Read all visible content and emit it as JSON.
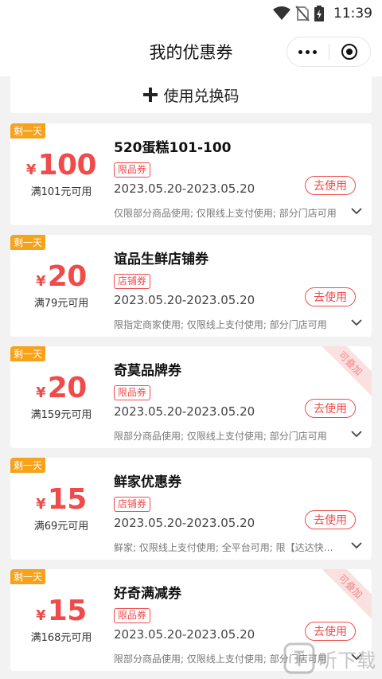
{
  "status_bar": {
    "time": "11:39"
  },
  "nav": {
    "title": "我的优惠券"
  },
  "redeem": {
    "icon": "plus-icon",
    "label": "使用兑换码"
  },
  "coupons": [
    {
      "tag": "剩一天",
      "yen": "¥",
      "amount": "100",
      "threshold": "满101元可用",
      "title": "520蛋糕101-100",
      "badge": "限品券",
      "dates": "2023.05.20-2023.05.20",
      "button": "去使用",
      "rule": "仅限部分商品使用; 仅限线上支付使用; 部分门店可用",
      "stackable": ""
    },
    {
      "tag": "剩一天",
      "yen": "¥",
      "amount": "20",
      "threshold": "满79元可用",
      "title": "谊品生鲜店铺券",
      "badge": "店铺券",
      "dates": "2023.05.20-2023.05.20",
      "button": "去使用",
      "rule": "限指定商家使用; 仅限线上支付使用; 部分门店可用",
      "stackable": ""
    },
    {
      "tag": "剩一天",
      "yen": "¥",
      "amount": "20",
      "threshold": "满159元可用",
      "title": "奇莫品牌券",
      "badge": "限品券",
      "dates": "2023.05.20-2023.05.20",
      "button": "去使用",
      "rule": "限部分商品使用; 仅限线上支付使用; 部分门店可用",
      "stackable": "可叠加"
    },
    {
      "tag": "剩一天",
      "yen": "¥",
      "amount": "15",
      "threshold": "满69元可用",
      "title": "鲜家优惠券",
      "badge": "店铺券",
      "dates": "2023.05.20-2023.05.20",
      "button": "去使用",
      "rule": "鲜家; 仅限线上支付使用; 全平台可用; 限【达达快送】",
      "stackable": ""
    },
    {
      "tag": "剩一天",
      "yen": "¥",
      "amount": "15",
      "threshold": "满168元可用",
      "title": "好奇满减券",
      "badge": "限品券",
      "dates": "2023.05.20-2023.05.20",
      "button": "去使用",
      "rule": "限部分商品使用; 仅限线上支付使用; 部分门店可用",
      "stackable": "可叠加"
    }
  ],
  "watermark": {
    "text": "听下载"
  },
  "colors": {
    "accent": "#f04b4b",
    "tag": "#f7a21b",
    "background": "#f2f2f2"
  }
}
